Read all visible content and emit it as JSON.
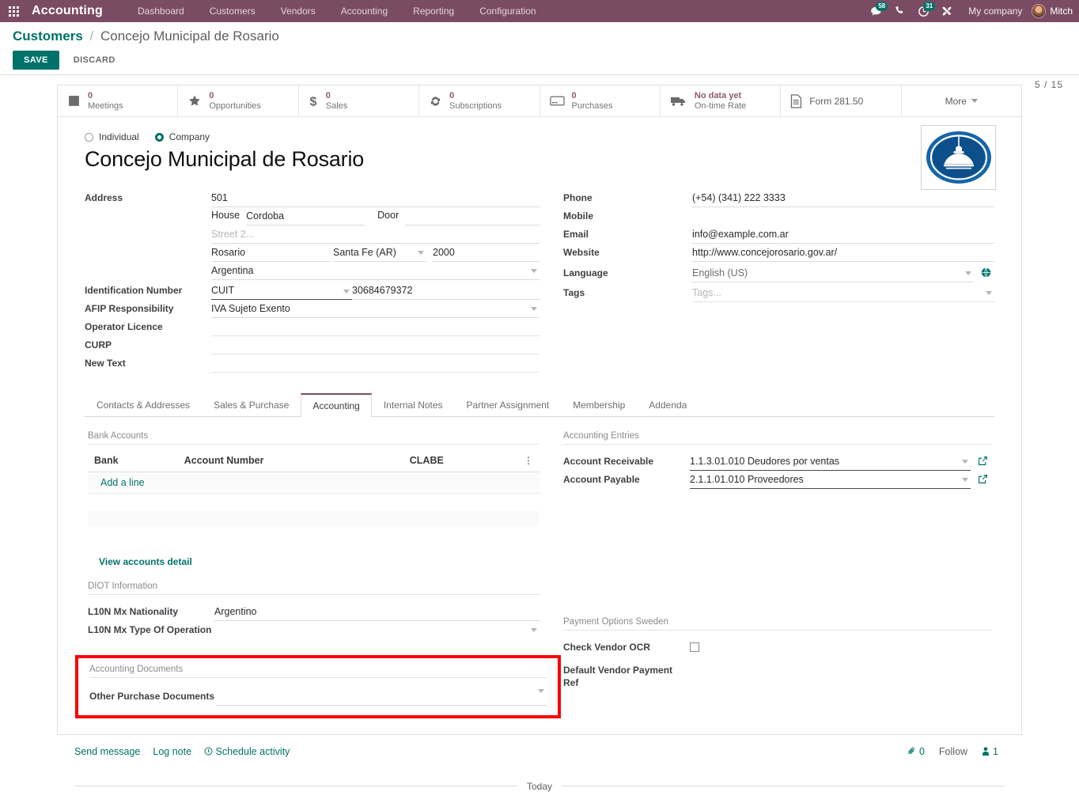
{
  "navbar": {
    "apps_icon": "apps-grid-icon",
    "brand": "Accounting",
    "menu": [
      "Dashboard",
      "Customers",
      "Vendors",
      "Accounting",
      "Reporting",
      "Configuration"
    ],
    "messages_badge": "58",
    "activities_badge": "31",
    "phone_icon": "phone-icon",
    "messages_icon": "messages-icon",
    "activities_icon": "clock-activities-icon",
    "debug_icon": "wrench-debug-icon",
    "company": "My company",
    "user": "Mitch"
  },
  "control_panel": {
    "breadcrumb_root": "Customers",
    "breadcrumb_sep": "/",
    "breadcrumb_current": "Concejo Municipal de Rosario",
    "save_label": "SAVE",
    "discard_label": "DISCARD",
    "pager": "5 / 15"
  },
  "stat_buttons": [
    {
      "icon": "calendar-icon",
      "value": "0",
      "label": "Meetings"
    },
    {
      "icon": "star-icon",
      "value": "0",
      "label": "Opportunities"
    },
    {
      "icon": "dollar-icon",
      "value": "0",
      "label": "Sales"
    },
    {
      "icon": "refresh-icon",
      "value": "0",
      "label": "Subscriptions"
    },
    {
      "icon": "credit-card-icon",
      "value": "0",
      "label": "Purchases"
    },
    {
      "icon": "truck-icon",
      "value": "No data yet",
      "label": "On-time Rate"
    },
    {
      "icon": "document-icon",
      "value": "",
      "label": "Form 281.50"
    },
    {
      "icon": "chevron-down-icon",
      "value": "",
      "label": "More"
    }
  ],
  "record": {
    "type_individual": "Individual",
    "type_company": "Company",
    "type_selected": "company",
    "name": "Concejo Municipal de Rosario",
    "logo_alt": "company-logo"
  },
  "left_form": {
    "address_label": "Address",
    "street": "501",
    "house_label": "House",
    "house": "Cordoba",
    "door_label": "Door",
    "door": "",
    "street2_placeholder": "Street 2...",
    "street2": "",
    "city": "Rosario",
    "state": "Santa Fe (AR)",
    "zip": "2000",
    "country": "Argentina",
    "id_number_label": "Identification Number",
    "id_type": "CUIT",
    "id_value": "30684679372",
    "afip_label": "AFIP Responsibility",
    "afip_value": "IVA Sujeto Exento",
    "operator_licence_label": "Operator Licence",
    "operator_licence": "",
    "curp_label": "CURP",
    "curp": "",
    "new_text_label": "New Text",
    "new_text": ""
  },
  "right_form": {
    "phone_label": "Phone",
    "phone": "(+54) (341) 222 3333",
    "mobile_label": "Mobile",
    "mobile": "",
    "email_label": "Email",
    "email": "info@example.com.ar",
    "website_label": "Website",
    "website": "http://www.concejorosario.gov.ar/",
    "language_label": "Language",
    "language": "English (US)",
    "tags_label": "Tags",
    "tags_placeholder": "Tags..."
  },
  "notebook": {
    "tabs": [
      "Contacts & Addresses",
      "Sales & Purchase",
      "Accounting",
      "Internal Notes",
      "Partner Assignment",
      "Membership",
      "Addenda"
    ],
    "active_tab": "Accounting"
  },
  "accounting_tab": {
    "bank_accounts": {
      "group_title": "Bank Accounts",
      "columns": [
        "Bank",
        "Account Number",
        "CLABE"
      ],
      "rows": [],
      "add_line": "Add a line",
      "options_icon": "vertical-dots-icon"
    },
    "view_accounts_detail": "View accounts detail",
    "diot": {
      "group_title": "DIOT Information",
      "nationality_label": "L10N Mx Nationality",
      "nationality": "Argentino",
      "type_of_operation_label": "L10N Mx Type Of Operation",
      "type_of_operation": ""
    },
    "accounting_entries": {
      "group_title": "Accounting Entries",
      "receivable_label": "Account Receivable",
      "receivable": "1.1.3.01.010 Deudores por ventas",
      "payable_label": "Account Payable",
      "payable": "2.1.1.01.010 Proveedores",
      "external_link_icon": "external-link-icon"
    },
    "payment_options": {
      "group_title": "Payment Options Sweden",
      "check_vendor_ocr_label": "Check Vendor OCR",
      "check_vendor_ocr": false,
      "default_vendor_payment_ref_label": "Default Vendor Payment Ref",
      "default_vendor_payment_ref": ""
    },
    "accounting_documents": {
      "group_title": "Accounting Documents",
      "other_purchase_documents_label": "Other Purchase Documents",
      "other_purchase_documents": "",
      "highlight_color": "#fb0000"
    }
  },
  "chatter": {
    "send_message": "Send message",
    "log_note": "Log note",
    "schedule_activity": "Schedule activity",
    "schedule_icon": "clock-icon",
    "attachment_icon": "paperclip-icon",
    "attachment_count": "0",
    "follow_label": "Follow",
    "followers_icon": "user-icon",
    "followers_count": "1",
    "today_label": "Today"
  },
  "theme": {
    "navbar_bg": "#7a4c63",
    "accent": "#00726a",
    "stat_value": "#8f5a6e",
    "highlight": "#fb0000"
  }
}
